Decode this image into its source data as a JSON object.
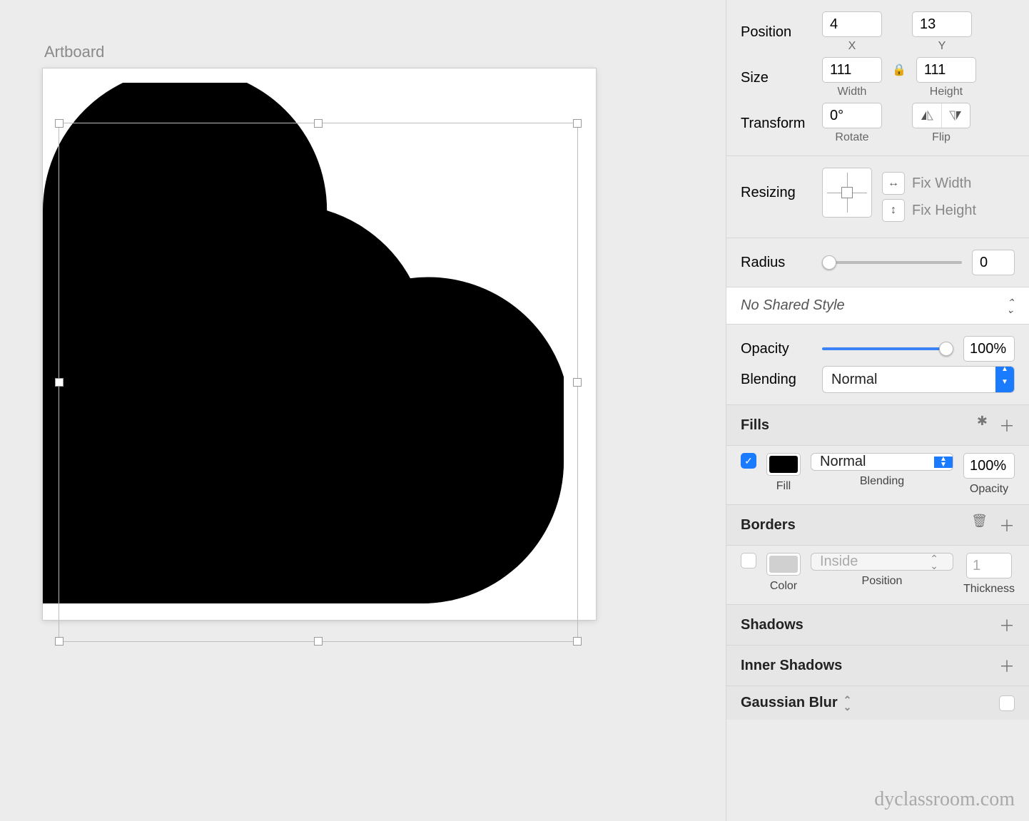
{
  "canvas": {
    "artboard_label": "Artboard"
  },
  "inspector": {
    "position": {
      "label": "Position",
      "x": "4",
      "y": "13",
      "x_sub": "X",
      "y_sub": "Y"
    },
    "size": {
      "label": "Size",
      "w": "111",
      "h": "111",
      "w_sub": "Width",
      "h_sub": "Height"
    },
    "transform": {
      "label": "Transform",
      "rotate": "0°",
      "rotate_sub": "Rotate",
      "flip_sub": "Flip"
    },
    "resizing": {
      "label": "Resizing",
      "fix_width": "Fix Width",
      "fix_height": "Fix Height"
    },
    "radius": {
      "label": "Radius",
      "value": "0"
    },
    "shared_style": "No Shared Style",
    "opacity": {
      "label": "Opacity",
      "value": "100%"
    },
    "blending": {
      "label": "Blending",
      "value": "Normal"
    },
    "fills": {
      "title": "Fills",
      "checked": true,
      "color": "#000000",
      "fill_sub": "Fill",
      "blend_value": "Normal",
      "blend_sub": "Blending",
      "opacity_value": "100%",
      "opacity_sub": "Opacity"
    },
    "borders": {
      "title": "Borders",
      "checked": false,
      "color": "#d0d0d0",
      "color_sub": "Color",
      "position_value": "Inside",
      "position_sub": "Position",
      "thickness_value": "1",
      "thickness_sub": "Thickness"
    },
    "shadows": {
      "title": "Shadows"
    },
    "inner_shadows": {
      "title": "Inner Shadows"
    },
    "gaussian_blur": {
      "title": "Gaussian Blur"
    }
  },
  "watermark": "dyclassroom.com"
}
